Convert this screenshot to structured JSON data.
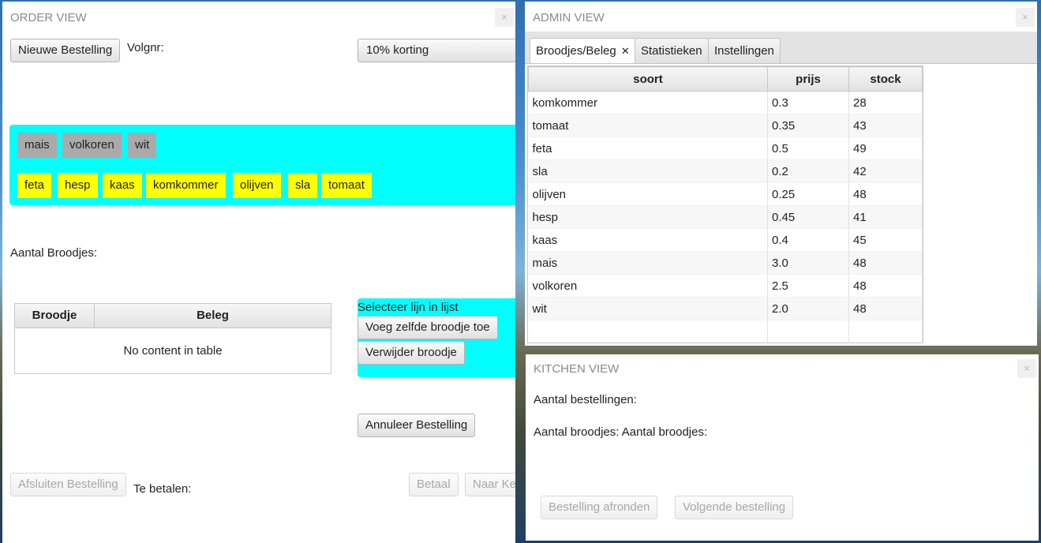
{
  "order": {
    "title": "ORDER VIEW",
    "close": "×",
    "new_order": "Nieuwe Bestelling",
    "volgnr_label": "Volgnr:",
    "discount_selected": "10% korting",
    "breads": [
      "mais",
      "volkoren",
      "wit"
    ],
    "toppings": [
      "feta",
      "hesp",
      "kaas",
      "komkommer",
      "olijven",
      "sla",
      "tomaat"
    ],
    "aantal_label": "Aantal Broodjes:",
    "table_headers": [
      "Broodje",
      "Beleg"
    ],
    "table_empty": "No content in table",
    "select_hint": "Selecteer lijn in lijst",
    "add_same": "Voeg zelfde broodje toe",
    "remove": "Verwijder broodje",
    "cancel_order": "Annuleer Bestelling",
    "close_order": "Afsluiten Bestelling",
    "to_pay": "Te betalen:",
    "pay": "Betaal",
    "to_kitchen": "Naar Ke"
  },
  "admin": {
    "title": "ADMIN VIEW",
    "close": "×",
    "tabs": [
      "Broodjes/Beleg",
      "Statistieken",
      "Instellingen"
    ],
    "tab_close": "✕",
    "headers": [
      "soort",
      "prijs",
      "stock"
    ],
    "rows": [
      [
        "komkommer",
        "0.3",
        "28"
      ],
      [
        "tomaat",
        "0.35",
        "43"
      ],
      [
        "feta",
        "0.5",
        "49"
      ],
      [
        "sla",
        "0.2",
        "42"
      ],
      [
        "olijven",
        "0.25",
        "48"
      ],
      [
        "hesp",
        "0.45",
        "41"
      ],
      [
        "kaas",
        "0.4",
        "45"
      ],
      [
        "mais",
        "3.0",
        "48"
      ],
      [
        "volkoren",
        "2.5",
        "48"
      ],
      [
        "wit",
        "2.0",
        "48"
      ]
    ]
  },
  "kitchen": {
    "title": "KITCHEN VIEW",
    "close": "×",
    "orders_label": "Aantal bestellingen:",
    "breads_label": "Aantal broodjes: Aantal broodjes:",
    "finish": "Bestelling afronden",
    "next": "Volgende bestelling"
  },
  "colors": {
    "cyan_panel": "#00ffff",
    "bread_chip": "#aaaaaa",
    "topping_chip": "#ffff00"
  }
}
